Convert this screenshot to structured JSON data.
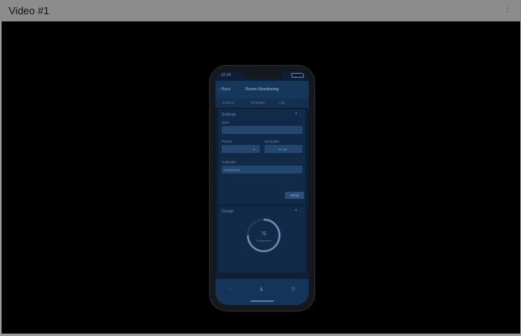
{
  "window": {
    "title": "Video #1"
  },
  "phone": {
    "status_time": "12:34",
    "nav": {
      "back_label": "Back",
      "title": "Room Monitoring"
    },
    "tabs": [
      "Control",
      "Schedule",
      "Log"
    ],
    "settings_card": {
      "title": "Settings",
      "user_label": "User",
      "preset_label": "Preset",
      "schedule_label": "Schedule",
      "schedule_value": "07:45",
      "calendar_label": "Calendar",
      "calendar_value": "10/15/2019",
      "send_label": "Send"
    },
    "gauge_card": {
      "title": "Gauge",
      "value": "75",
      "unit_label": "Temperature",
      "fraction": 0.75
    }
  },
  "colors": {
    "accent": "#24476f",
    "background": "#000000"
  }
}
